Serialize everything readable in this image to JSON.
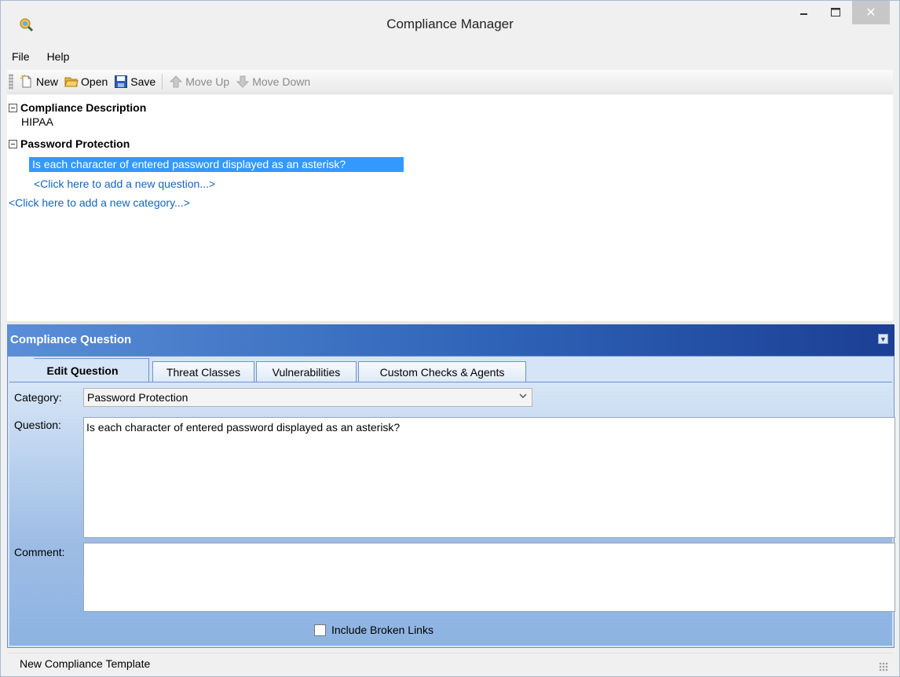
{
  "window": {
    "title": "Compliance Manager"
  },
  "menu": {
    "items": [
      "File",
      "Help"
    ]
  },
  "toolbar": {
    "new_label": "New",
    "open_label": "Open",
    "save_label": "Save",
    "move_up_label": "Move Up",
    "move_down_label": "Move Down"
  },
  "tree": {
    "description_header": "Compliance Description",
    "description_value": "HIPAA",
    "category_header": "Password Protection",
    "selected_question": "Is each character of entered password displayed as an asterisk?",
    "add_question_link": "<Click here to add a new question...>",
    "add_category_link": "<Click here to add a new category...>"
  },
  "panel": {
    "title": "Compliance Question",
    "tabs": [
      "Edit Question",
      "Threat Classes",
      "Vulnerabilities",
      "Custom Checks & Agents"
    ],
    "category_label": "Category:",
    "category_value": "Password Protection",
    "question_label": "Question:",
    "question_value": "Is each character of entered password displayed as an asterisk?",
    "comment_label": "Comment:",
    "comment_value": "",
    "checkbox_label": "Include Broken Links"
  },
  "status": {
    "text": "New Compliance Template"
  },
  "colors": {
    "selection": "#3399ff",
    "link": "#1565c0",
    "panel_header": "#2e63b7"
  },
  "icons": [
    "app-icon",
    "minimize-icon",
    "maximize-icon",
    "close-icon",
    "new-file-icon",
    "open-folder-icon",
    "save-disk-icon",
    "arrow-up-icon",
    "arrow-down-icon",
    "collapse-icon",
    "dropdown-arrow-icon"
  ]
}
